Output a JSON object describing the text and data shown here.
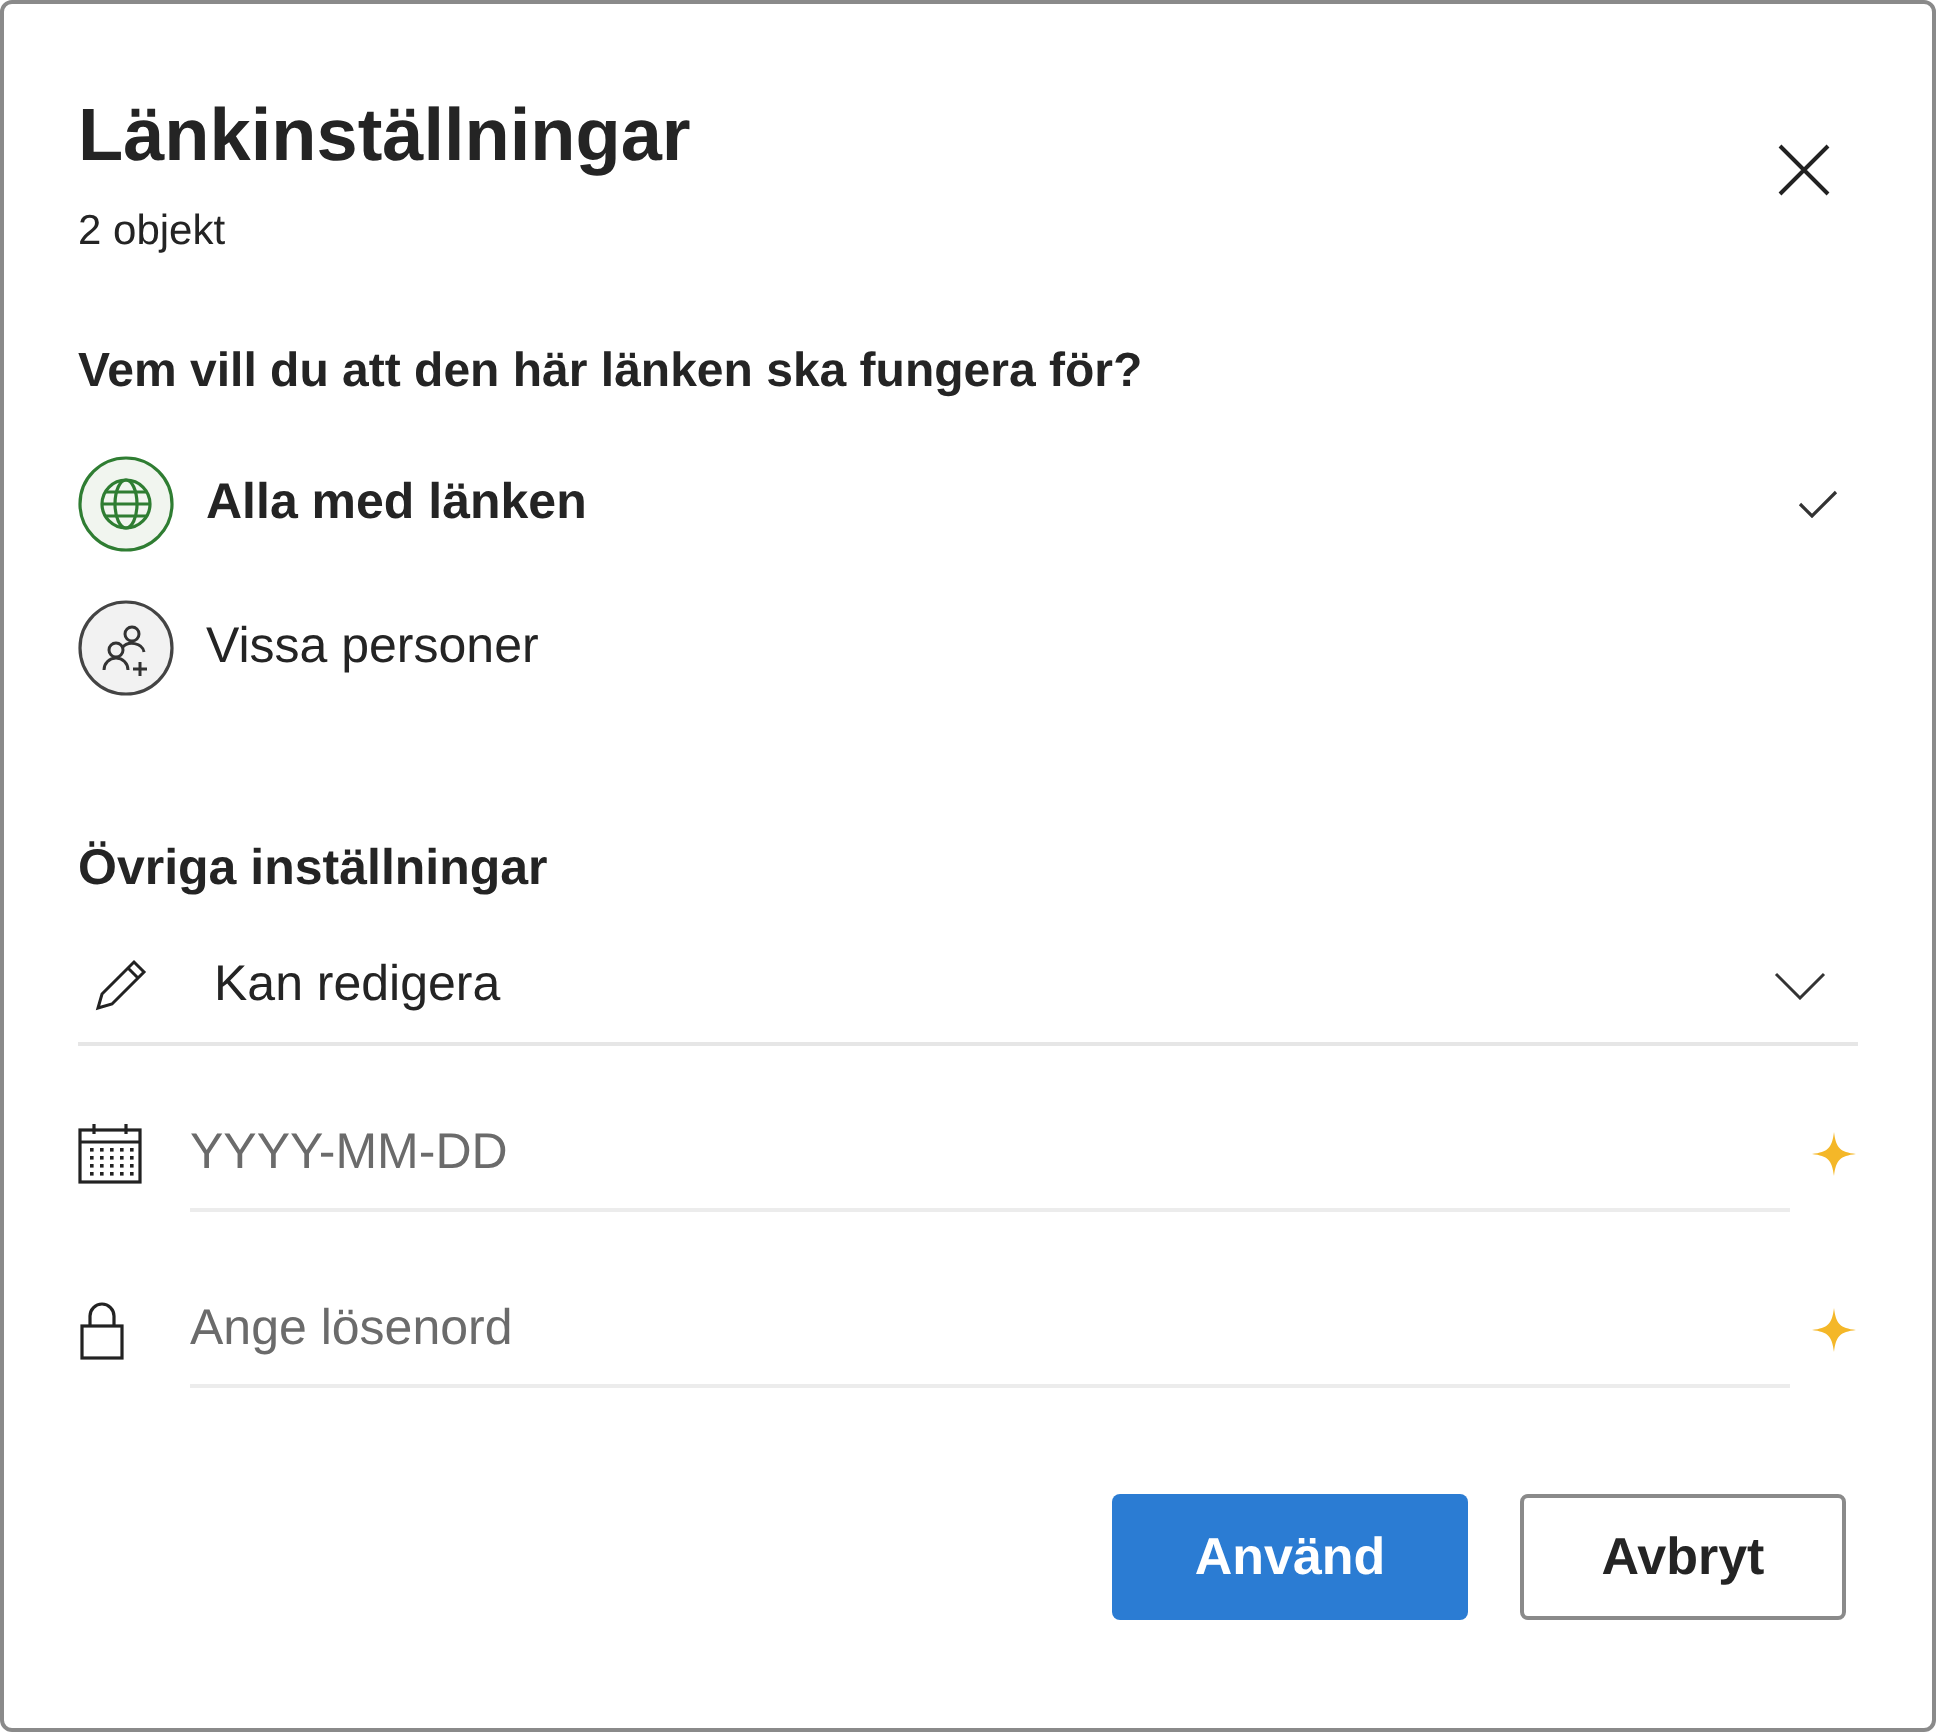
{
  "dialog": {
    "title": "Länkinställningar",
    "subtitle": "2 objekt"
  },
  "audience": {
    "question": "Vem vill du att den här länken ska fungera för?",
    "options": [
      {
        "label": "Alla med länken",
        "kind": "globe",
        "selected": true
      },
      {
        "label": "Vissa personer",
        "kind": "people",
        "selected": false
      }
    ]
  },
  "other_settings": {
    "heading": "Övriga inställningar",
    "permission": {
      "value": "Kan redigera"
    },
    "fields": [
      {
        "kind": "date",
        "placeholder": "YYYY-MM-DD"
      },
      {
        "kind": "password",
        "placeholder": "Ange lösenord"
      }
    ]
  },
  "buttons": [
    {
      "label": "Använd",
      "kind": "primary"
    },
    {
      "label": "Avbryt",
      "kind": "secondary"
    }
  ]
}
